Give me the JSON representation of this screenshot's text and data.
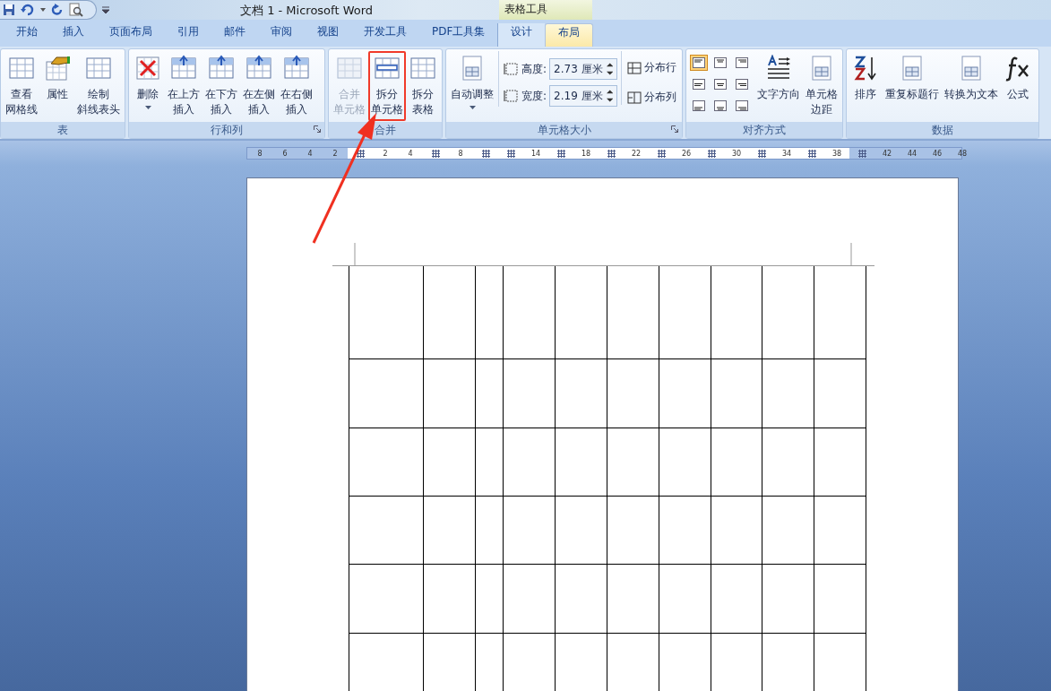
{
  "title_bar": {
    "title": "文档 1 - Microsoft Word",
    "context_label": "表格工具"
  },
  "tabs": [
    {
      "label": "开始",
      "selected": false,
      "contextual": false
    },
    {
      "label": "插入",
      "selected": false,
      "contextual": false
    },
    {
      "label": "页面布局",
      "selected": false,
      "contextual": false
    },
    {
      "label": "引用",
      "selected": false,
      "contextual": false
    },
    {
      "label": "邮件",
      "selected": false,
      "contextual": false
    },
    {
      "label": "审阅",
      "selected": false,
      "contextual": false
    },
    {
      "label": "视图",
      "selected": false,
      "contextual": false
    },
    {
      "label": "开发工具",
      "selected": false,
      "contextual": false
    },
    {
      "label": "PDF工具集",
      "selected": false,
      "contextual": false
    },
    {
      "label": "设计",
      "selected": false,
      "contextual": true
    },
    {
      "label": "布局",
      "selected": true,
      "contextual": true
    }
  ],
  "groups": [
    {
      "label": "表",
      "dialog_launcher": false,
      "items": [
        {
          "kind": "large",
          "lines": [
            "查看",
            "网格线"
          ],
          "disabled": false,
          "highlighted": false,
          "dropdown": false
        },
        {
          "kind": "large",
          "lines": [
            "属性"
          ],
          "disabled": false,
          "highlighted": false,
          "dropdown": false
        },
        {
          "kind": "large",
          "lines": [
            "绘制",
            "斜线表头"
          ],
          "disabled": false,
          "highlighted": false,
          "dropdown": false
        }
      ]
    },
    {
      "label": "行和列",
      "dialog_launcher": true,
      "items": [
        {
          "kind": "large",
          "lines": [
            "删除"
          ],
          "disabled": false,
          "highlighted": false,
          "dropdown": true
        },
        {
          "kind": "large",
          "lines": [
            "在上方",
            "插入"
          ],
          "disabled": false,
          "highlighted": false,
          "dropdown": false
        },
        {
          "kind": "large",
          "lines": [
            "在下方",
            "插入"
          ],
          "disabled": false,
          "highlighted": false,
          "dropdown": false
        },
        {
          "kind": "large",
          "lines": [
            "在左侧",
            "插入"
          ],
          "disabled": false,
          "highlighted": false,
          "dropdown": false
        },
        {
          "kind": "large",
          "lines": [
            "在右侧",
            "插入"
          ],
          "disabled": false,
          "highlighted": false,
          "dropdown": false
        }
      ]
    },
    {
      "label": "合并",
      "dialog_launcher": false,
      "items": [
        {
          "kind": "large",
          "lines": [
            "合并",
            "单元格"
          ],
          "disabled": true,
          "highlighted": false,
          "dropdown": false
        },
        {
          "kind": "large",
          "lines": [
            "拆分",
            "单元格"
          ],
          "disabled": false,
          "highlighted": true,
          "dropdown": false
        },
        {
          "kind": "large",
          "lines": [
            "拆分",
            "表格"
          ],
          "disabled": false,
          "highlighted": false,
          "dropdown": false
        }
      ]
    },
    {
      "label": "单元格大小",
      "dialog_launcher": true,
      "items": [
        {
          "kind": "large",
          "lines": [
            "自动调整"
          ],
          "disabled": false,
          "highlighted": false,
          "dropdown": true
        },
        {
          "kind": "fields",
          "fields": [
            {
              "label": "高度:",
              "value": "2.73 厘米"
            },
            {
              "label": "宽度:",
              "value": "2.19 厘米"
            }
          ]
        },
        {
          "kind": "smalls",
          "buttons": [
            {
              "label": "分布行"
            },
            {
              "label": "分布列"
            }
          ]
        }
      ]
    },
    {
      "label": "对齐方式",
      "dialog_launcher": false,
      "items": [
        {
          "kind": "align",
          "cells": [
            {
              "selected": true
            },
            {
              "selected": false
            },
            {
              "selected": false
            },
            {
              "selected": false
            },
            {
              "selected": false
            },
            {
              "selected": false
            },
            {
              "selected": false
            },
            {
              "selected": false
            },
            {
              "selected": false
            }
          ]
        },
        {
          "kind": "large",
          "lines": [
            "文字方向"
          ],
          "disabled": false,
          "highlighted": false,
          "dropdown": false
        },
        {
          "kind": "large",
          "lines": [
            "单元格",
            "边距"
          ],
          "disabled": false,
          "highlighted": false,
          "dropdown": false
        }
      ]
    },
    {
      "label": "数据",
      "dialog_launcher": false,
      "items": [
        {
          "kind": "large",
          "lines": [
            "排序"
          ],
          "disabled": false,
          "highlighted": false,
          "dropdown": false
        },
        {
          "kind": "large",
          "lines": [
            "重复标题行"
          ],
          "disabled": false,
          "highlighted": false,
          "dropdown": false
        },
        {
          "kind": "large",
          "lines": [
            "转换为文本"
          ],
          "disabled": false,
          "highlighted": false,
          "dropdown": false
        },
        {
          "kind": "large",
          "lines": [
            "公式"
          ],
          "disabled": false,
          "highlighted": false,
          "dropdown": false
        }
      ]
    }
  ],
  "ruler": [
    {
      "kind": "number",
      "label": "8"
    },
    {
      "kind": "number",
      "label": "6"
    },
    {
      "kind": "number",
      "label": "4"
    },
    {
      "kind": "number",
      "label": "2"
    },
    {
      "kind": "marker"
    },
    {
      "kind": "number",
      "label": "2"
    },
    {
      "kind": "number",
      "label": "4"
    },
    {
      "kind": "marker"
    },
    {
      "kind": "number",
      "label": "8"
    },
    {
      "kind": "marker"
    },
    {
      "kind": "marker"
    },
    {
      "kind": "number",
      "label": "14"
    },
    {
      "kind": "marker"
    },
    {
      "kind": "number",
      "label": "18"
    },
    {
      "kind": "marker"
    },
    {
      "kind": "number",
      "label": "22"
    },
    {
      "kind": "marker"
    },
    {
      "kind": "number",
      "label": "26"
    },
    {
      "kind": "marker"
    },
    {
      "kind": "number",
      "label": "30"
    },
    {
      "kind": "marker"
    },
    {
      "kind": "number",
      "label": "34"
    },
    {
      "kind": "marker"
    },
    {
      "kind": "number",
      "label": "38"
    },
    {
      "kind": "marker"
    },
    {
      "kind": "number",
      "label": "42"
    },
    {
      "kind": "number",
      "label": "44"
    },
    {
      "kind": "number",
      "label": "46"
    },
    {
      "kind": "number",
      "label": "48"
    }
  ]
}
